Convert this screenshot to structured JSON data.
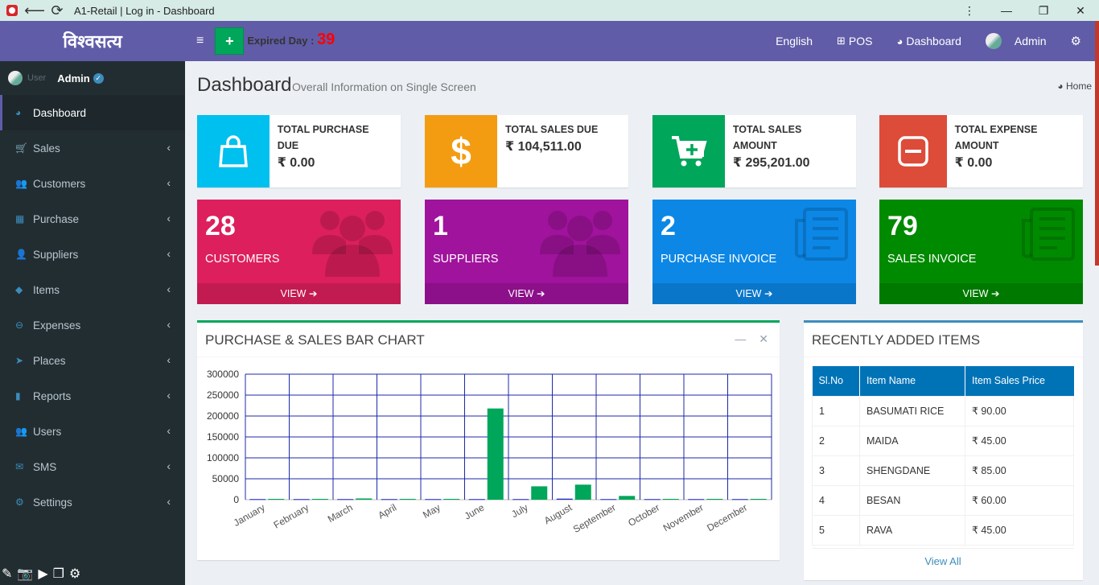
{
  "window": {
    "title": "A1-Retail | Log in - Dashboard",
    "back_glyph": "⟵",
    "reload_glyph": "⟳",
    "controls": [
      "⋮",
      "—",
      "❐",
      "✕"
    ]
  },
  "sidebar": {
    "logo": "विश्वसत्य",
    "user_faded": "User",
    "user_name": "Admin",
    "items": [
      {
        "label": "Dashboard",
        "icon": "dashboard-icon",
        "glyph": "◕",
        "active": true
      },
      {
        "label": "Sales",
        "icon": "cart-icon",
        "glyph": "🛒"
      },
      {
        "label": "Customers",
        "icon": "users-icon",
        "glyph": "👥"
      },
      {
        "label": "Purchase",
        "icon": "grid-icon",
        "glyph": "▦"
      },
      {
        "label": "Suppliers",
        "icon": "user-plus-icon",
        "glyph": "👤"
      },
      {
        "label": "Items",
        "icon": "cubes-icon",
        "glyph": "◆"
      },
      {
        "label": "Expenses",
        "icon": "minus-circle-icon",
        "glyph": "⊖"
      },
      {
        "label": "Places",
        "icon": "paper-plane-icon",
        "glyph": "➤"
      },
      {
        "label": "Reports",
        "icon": "bar-chart-icon",
        "glyph": "▮"
      },
      {
        "label": "Users",
        "icon": "users-icon",
        "glyph": "👥"
      },
      {
        "label": "SMS",
        "icon": "envelope-icon",
        "glyph": "✉"
      },
      {
        "label": "Settings",
        "icon": "cogs-icon",
        "glyph": "⚙"
      }
    ],
    "chevron": "‹",
    "bottom_tools": [
      "✎",
      "📷",
      "▶",
      "❐",
      "⚙"
    ]
  },
  "header": {
    "hamburger": "≡",
    "plus": "+",
    "expired_label": "Expired Day :",
    "expired_days": "39",
    "language": "English",
    "pos": "POS",
    "pos_glyph": "⊞",
    "dashboard": "Dashboard",
    "dashboard_glyph": "◕",
    "admin": "Admin",
    "gears_glyph": "⚙"
  },
  "page": {
    "title": "Dashboard",
    "subtitle": "Overall Information on Single Screen",
    "breadcrumb": "Home",
    "breadcrumb_glyph": "◕"
  },
  "info_boxes": [
    {
      "label": "TOTAL PURCHASE DUE",
      "value": "₹ 0.00",
      "color": "#00c0ef",
      "icon": "shopping-bag-icon"
    },
    {
      "label": "TOTAL SALES DUE",
      "value": "₹ 104,511.00",
      "color": "#f39c12",
      "icon": "dollar-icon"
    },
    {
      "label": "TOTAL SALES AMOUNT",
      "value": "₹ 295,201.00",
      "color": "#00a65a",
      "icon": "cart-plus-icon"
    },
    {
      "label": "TOTAL EXPENSE AMOUNT",
      "value": "₹ 0.00",
      "color": "#dd4b39",
      "icon": "minus-square-icon"
    }
  ],
  "small_boxes": [
    {
      "number": "28",
      "label": "CUSTOMERS",
      "footer": "VIEW",
      "color": "#dd1f5d",
      "icon": "users-icon"
    },
    {
      "number": "1",
      "label": "SUPPLIERS",
      "footer": "VIEW",
      "color": "#a0139c",
      "icon": "users-icon"
    },
    {
      "number": "2",
      "label": "PURCHASE INVOICE",
      "footer": "VIEW",
      "color": "#0c87e6",
      "icon": "newspaper-icon"
    },
    {
      "number": "79",
      "label": "SALES INVOICE",
      "footer": "VIEW",
      "color": "#008a00",
      "icon": "newspaper-icon"
    }
  ],
  "footer_arrow": "➔",
  "chart_panel": {
    "title": "PURCHASE & SALES BAR CHART",
    "minimize": "—",
    "close": "✕",
    "border_color": "#00a65a"
  },
  "chart_data": {
    "type": "bar",
    "categories": [
      "January",
      "February",
      "March",
      "April",
      "May",
      "June",
      "July",
      "August",
      "September",
      "October",
      "November",
      "December"
    ],
    "series": [
      {
        "values": [
          1500,
          1500,
          1500,
          1500,
          1500,
          1500,
          1500,
          2500,
          1500,
          1500,
          1500,
          1500
        ],
        "color": "#1c28c9"
      },
      {
        "values": [
          2000,
          2000,
          3000,
          2000,
          2000,
          218000,
          32000,
          36000,
          9000,
          2000,
          2000,
          2000
        ],
        "color": "#00a65a"
      }
    ],
    "yticks": [
      "0",
      "50000",
      "100000",
      "150000",
      "200000",
      "250000",
      "300000"
    ],
    "ylim": [
      0,
      300000
    ],
    "grid": true,
    "grid_color": "#1c28a8"
  },
  "items_panel": {
    "title": "RECENTLY ADDED ITEMS",
    "border_color": "#3c8dbc",
    "headers": [
      "Sl.No",
      "Item Name",
      "Item Sales Price"
    ],
    "rows": [
      [
        "1",
        "BASUMATI RICE",
        "₹ 90.00"
      ],
      [
        "2",
        "MAIDA",
        "₹ 45.00"
      ],
      [
        "3",
        "SHENGDANE",
        "₹ 85.00"
      ],
      [
        "4",
        "BESAN",
        "₹ 60.00"
      ],
      [
        "5",
        "RAVA",
        "₹ 45.00"
      ]
    ],
    "view_all": "View All"
  }
}
